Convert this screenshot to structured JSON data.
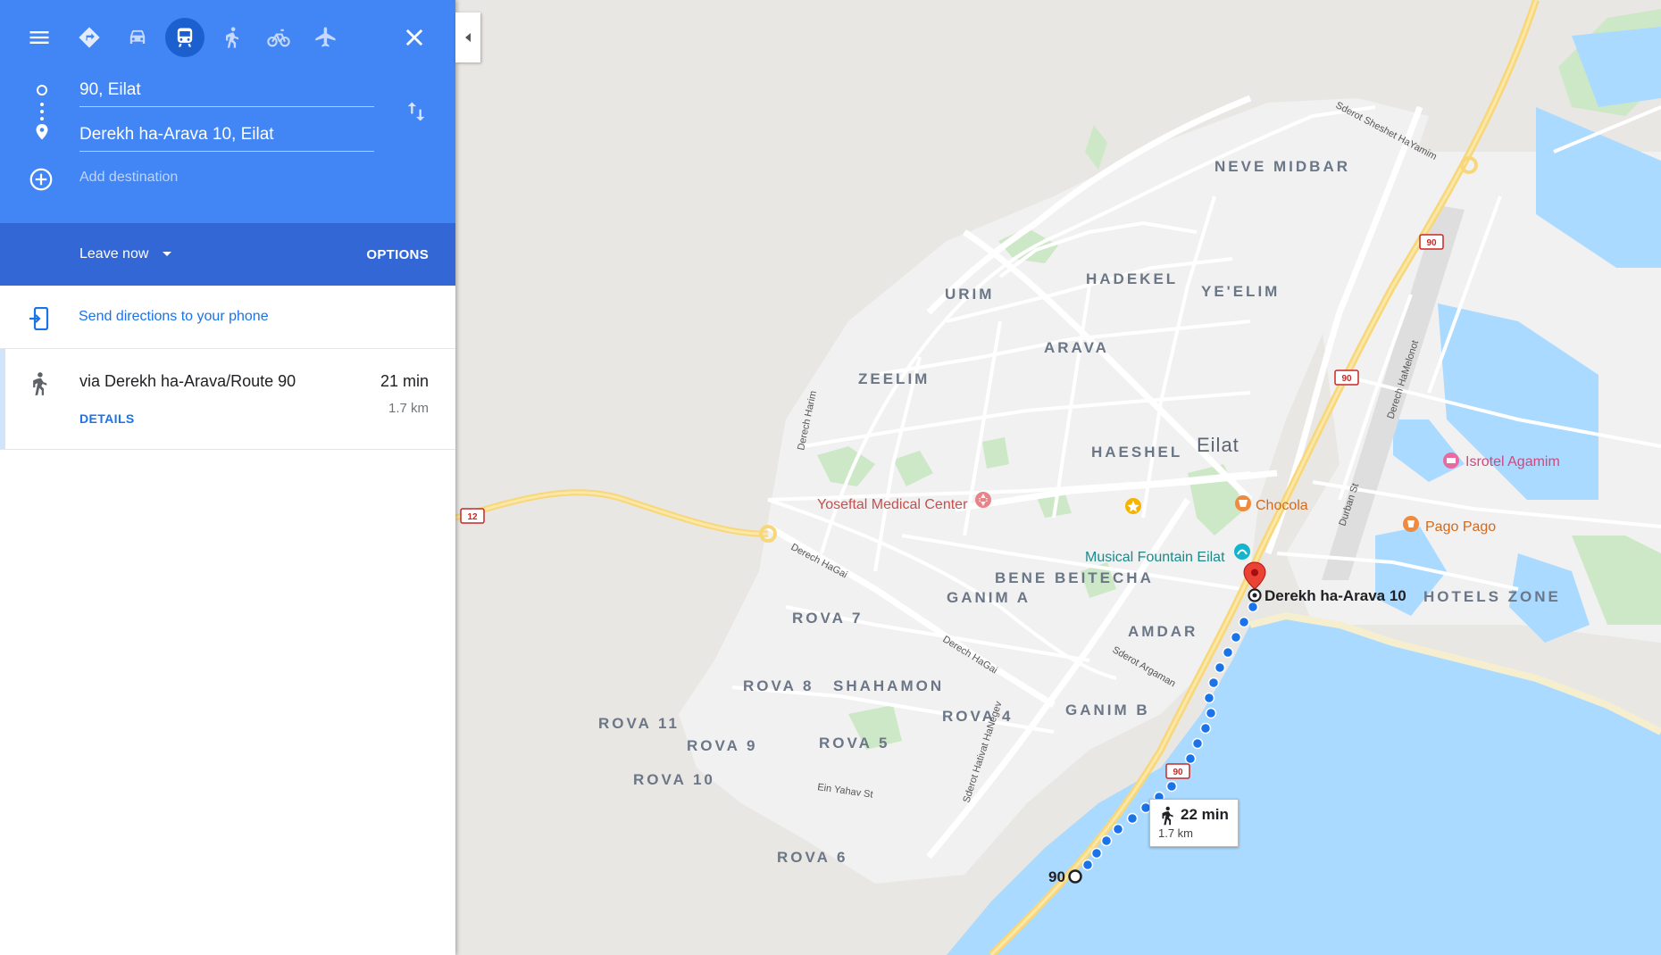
{
  "header": {
    "origin": "90, Eilat",
    "destination": "Derekh ha-Arava 10, Eilat",
    "add_destination": "Add destination",
    "modes": [
      "menu-icon",
      "directions-icon",
      "car-icon",
      "transit-icon",
      "walk-icon",
      "bike-icon",
      "flight-icon"
    ],
    "active_mode": "transit",
    "accent": "#4285f4",
    "accent_dark": "#3367d6"
  },
  "leave": {
    "label": "Leave now",
    "options": "OPTIONS"
  },
  "send": {
    "label": "Send directions to your phone"
  },
  "route": {
    "via": "via Derekh ha-Arava/Route 90",
    "time": "21 min",
    "distance": "1.7 km",
    "details": "DETAILS"
  },
  "map": {
    "city": "Eilat",
    "areas": [
      "NEVE MIDBAR",
      "HADEKEL",
      "YE'ELIM",
      "URIM",
      "ARAVA",
      "ZEELIM",
      "HAESHEL",
      "BENE BEITECHA",
      "GANIM A",
      "ROVA 7",
      "AMDAR",
      "HOTELS ZONE",
      "ROVA 8",
      "SHAHAMON",
      "ROVA 4",
      "GANIM B",
      "ROVA 11",
      "ROVA 9",
      "ROVA 5",
      "ROVA 10",
      "ROVA 6"
    ],
    "streets": [
      "Sderot Sheshet HaYamim",
      "Derech Harim",
      "Derech HaGai",
      "Derech HaGai",
      "Sderot Argaman",
      "Sderot Hativat HaNegev",
      "Ein Yahav St",
      "Derech HaMelonot",
      "Durban St"
    ],
    "pois": [
      "Yoseftal Medical Center",
      "Chocola",
      "Musical Fountain Eilat",
      "Isrotel Agamim",
      "Pago Pago"
    ],
    "shields": [
      "90",
      "90",
      "90",
      "12"
    ],
    "destination_label": "Derekh ha-Arava 10",
    "origin_label": "90",
    "bubble": {
      "time": "22 min",
      "distance": "1.7 km"
    }
  }
}
